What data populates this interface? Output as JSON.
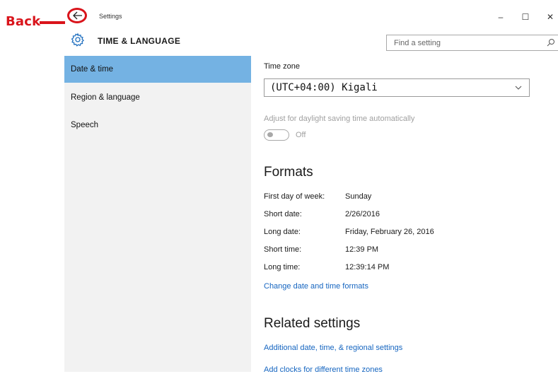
{
  "annotation": {
    "back_label": "Back",
    "color": "#d9141b"
  },
  "window": {
    "title": "Settings",
    "controls": {
      "minimize": "–",
      "maximize": "☐",
      "close": "✕"
    }
  },
  "header": {
    "title": "TIME & LANGUAGE",
    "icon": "gear-icon",
    "search_placeholder": "Find a setting"
  },
  "sidebar": {
    "items": [
      {
        "label": "Date & time",
        "selected": true
      },
      {
        "label": "Region & language",
        "selected": false
      },
      {
        "label": "Speech",
        "selected": false
      }
    ],
    "accent": "#74b2e3"
  },
  "main": {
    "time_zone": {
      "label": "Time zone",
      "value": "(UTC+04:00) Kigali"
    },
    "daylight": {
      "label": "Adjust for daylight saving time automatically",
      "state": "Off",
      "enabled": false
    },
    "formats": {
      "title": "Formats",
      "rows": [
        {
          "label": "First day of week:",
          "value": "Sunday"
        },
        {
          "label": "Short date:",
          "value": "2/26/2016"
        },
        {
          "label": "Long date:",
          "value": "Friday, February 26, 2016"
        },
        {
          "label": "Short time:",
          "value": "12:39 PM"
        },
        {
          "label": "Long time:",
          "value": "12:39:14 PM"
        }
      ],
      "change_link": "Change date and time formats"
    },
    "related": {
      "title": "Related settings",
      "links": [
        "Additional date, time, & regional settings",
        "Add clocks for different time zones"
      ]
    },
    "link_color": "#1565c0"
  }
}
